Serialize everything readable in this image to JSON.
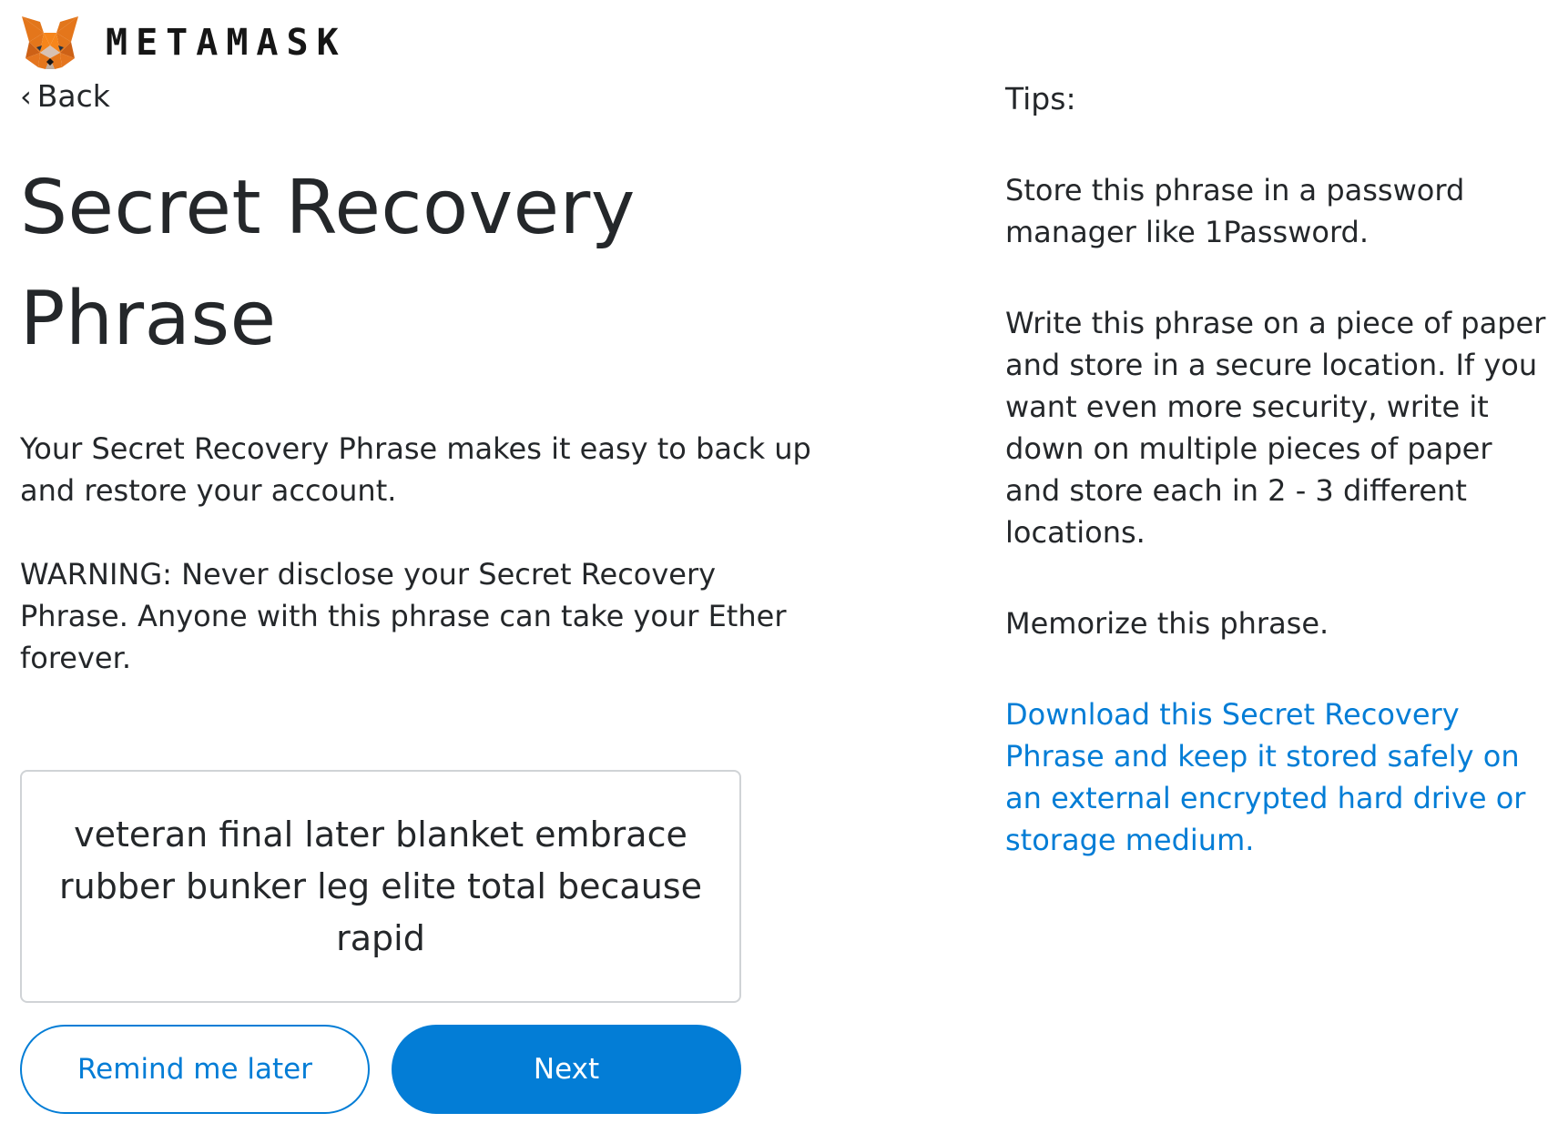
{
  "header": {
    "brand": "METAMASK",
    "logo_icon": "fox-icon"
  },
  "nav": {
    "back_label": "Back"
  },
  "main": {
    "title_line1": "Secret Recovery",
    "title_line2": "Phrase",
    "description": "Your Secret Recovery Phrase makes it easy to back up and restore your account.",
    "warning": "WARNING: Never disclose your Secret Recovery Phrase. Anyone with this phrase can take your Ether forever.",
    "phrase": "veteran final later blanket embrace rubber bunker leg elite total because rapid"
  },
  "actions": {
    "remind_label": "Remind me later",
    "next_label": "Next"
  },
  "tips": {
    "heading": "Tips:",
    "items": [
      "Store this phrase in a password manager like 1Password.",
      "Write this phrase on a piece of paper and store in a secure location. If you want even more security, write it down on multiple pieces of paper and store each in 2 - 3 different locations.",
      "Memorize this phrase."
    ],
    "download_link": "Download this Secret Recovery Phrase and keep it stored safely on an external encrypted hard drive or storage medium."
  },
  "colors": {
    "accent": "#037dd6",
    "text": "#24272a",
    "border": "#d0d3d6"
  }
}
